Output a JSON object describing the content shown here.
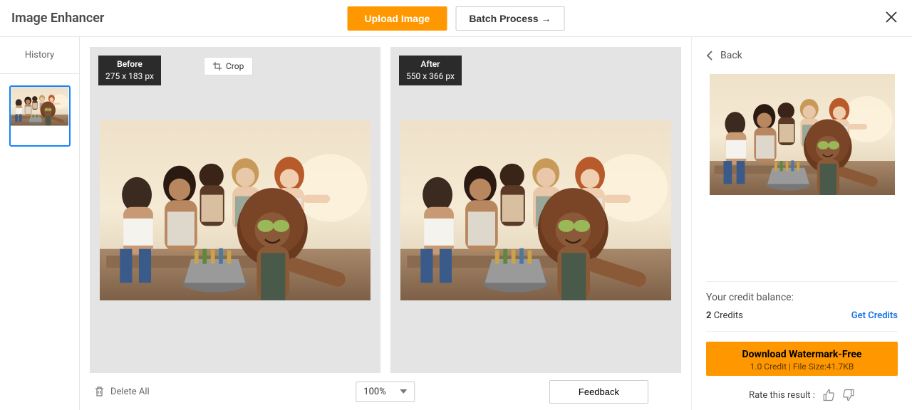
{
  "header": {
    "title": "Image Enhancer",
    "upload": "Upload Image",
    "batch": "Batch Process →"
  },
  "sidebar": {
    "history": "History"
  },
  "before": {
    "label": "Before",
    "dims": "275 x 183 px",
    "crop": "Crop"
  },
  "after": {
    "label": "After",
    "dims": "550 x 366 px"
  },
  "footer": {
    "delete_all": "Delete All",
    "zoom": "100%",
    "feedback": "Feedback"
  },
  "right": {
    "back": "Back",
    "credit_label": "Your credit balance:",
    "credit_num": "2",
    "credit_word": "Credits",
    "get_credits": "Get Credits",
    "download_l1": "Download Watermark-Free",
    "download_l2": "1.0 Credit | File Size:41.7KB",
    "rate": "Rate this result :"
  }
}
